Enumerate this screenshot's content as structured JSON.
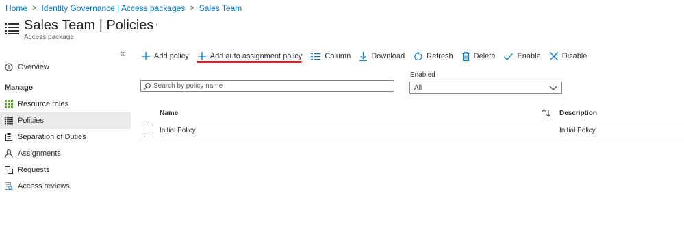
{
  "breadcrumb": {
    "items": [
      "Home",
      "Identity Governance | Access packages",
      "Sales Team"
    ]
  },
  "header": {
    "title_main": "Sales Team",
    "title_section": "Policies",
    "subtitle": "Access package",
    "more": "···",
    "icon": "list-icon"
  },
  "sidebar": {
    "collapse": "«",
    "overview": "Overview",
    "section_header": "Manage",
    "items": [
      {
        "label": "Resource roles",
        "icon": "grid-icon"
      },
      {
        "label": "Policies",
        "icon": "list-icon",
        "active": true
      },
      {
        "label": "Separation of Duties",
        "icon": "clipboard-icon"
      },
      {
        "label": "Assignments",
        "icon": "person-icon"
      },
      {
        "label": "Requests",
        "icon": "requests-icon"
      },
      {
        "label": "Access reviews",
        "icon": "review-icon"
      }
    ]
  },
  "toolbar": {
    "add_policy": "Add policy",
    "add_auto": "Add auto assignment policy",
    "column": "Column",
    "download": "Download",
    "refresh": "Refresh",
    "delete": "Delete",
    "enable": "Enable",
    "disable": "Disable"
  },
  "search": {
    "placeholder": "Search by policy name",
    "value": ""
  },
  "filter": {
    "label": "Enabled",
    "value": "All"
  },
  "table": {
    "columns": [
      "Name",
      "Description"
    ],
    "rows": [
      {
        "name": "Initial Policy",
        "description": "Initial Policy"
      }
    ]
  },
  "colors": {
    "accent": "#0078d4",
    "highlight": "#d9272e",
    "active_bg": "#edebe9"
  }
}
